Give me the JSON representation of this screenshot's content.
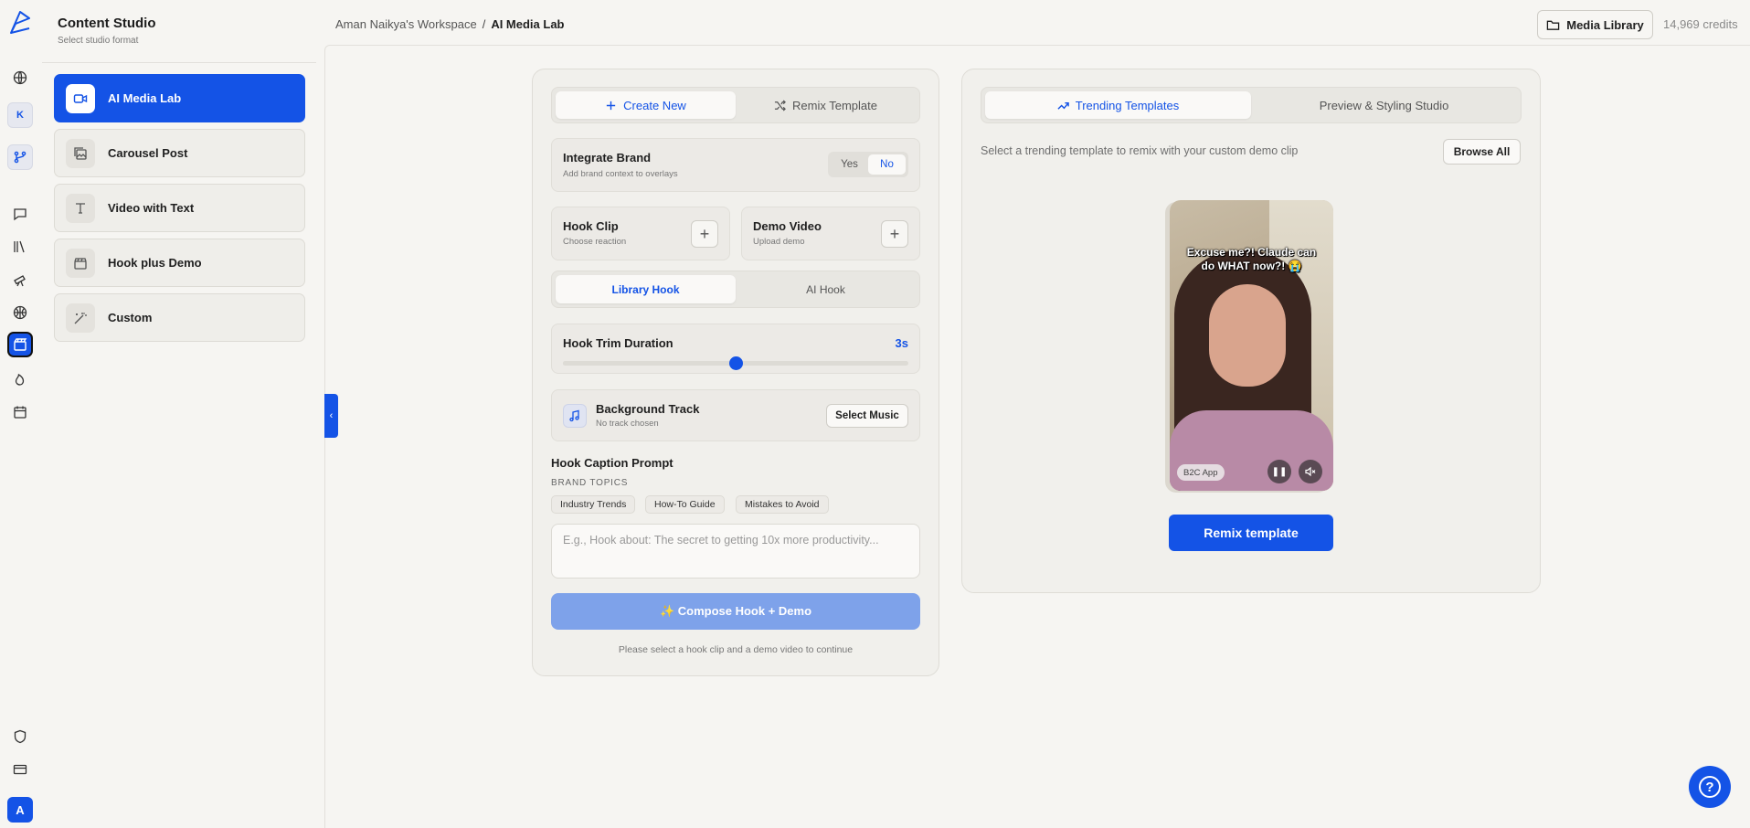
{
  "sidebar": {
    "title": "Content Studio",
    "subtitle": "Select studio format",
    "workspace_initial": "K",
    "user_initial": "A",
    "formats": [
      {
        "label": "AI Media Lab",
        "icon": "video-icon"
      },
      {
        "label": "Carousel Post",
        "icon": "images-icon"
      },
      {
        "label": "Video with Text",
        "icon": "text-icon"
      },
      {
        "label": "Hook plus Demo",
        "icon": "clapper-icon"
      },
      {
        "label": "Custom",
        "icon": "wand-icon"
      }
    ]
  },
  "header": {
    "workspace": "Aman Naikya's Workspace",
    "separator": "/",
    "current": "AI Media Lab",
    "media_library": "Media Library",
    "credits": "14,969 credits"
  },
  "left": {
    "tabs": {
      "create": "Create New",
      "remix": "Remix Template"
    },
    "brand": {
      "title": "Integrate Brand",
      "subtitle": "Add brand context to overlays",
      "yes": "Yes",
      "no": "No"
    },
    "hook_clip": {
      "title": "Hook Clip",
      "subtitle": "Choose reaction",
      "add": "+"
    },
    "demo_video": {
      "title": "Demo Video",
      "subtitle": "Upload demo",
      "add": "+"
    },
    "hook_tabs": {
      "library": "Library Hook",
      "ai": "AI Hook"
    },
    "trim": {
      "title": "Hook Trim Duration",
      "value_label": "3s",
      "fraction": 0.5
    },
    "music": {
      "title": "Background Track",
      "subtitle": "No track chosen",
      "button": "Select Music"
    },
    "caption": {
      "title": "Hook Caption Prompt",
      "topics_label": "BRAND TOPICS",
      "topics": [
        "Industry Trends",
        "How-To Guide",
        "Mistakes to Avoid"
      ],
      "placeholder": "E.g., Hook about: The secret to getting 10x more productivity..."
    },
    "compose": "✨ Compose Hook + Demo",
    "hint": "Please select a hook clip and a demo video to continue"
  },
  "right": {
    "tabs": {
      "trending": "Trending Templates",
      "preview": "Preview & Styling Studio"
    },
    "description": "Select a trending template to remix with your custom demo clip",
    "browse": "Browse All",
    "video": {
      "caption": "Excuse me?! Claude can do WHAT now?! 😭",
      "tag": "B2C App"
    },
    "remix": "Remix template"
  },
  "colors": {
    "accent": "#1453e6",
    "background": "#f6f5f2"
  }
}
